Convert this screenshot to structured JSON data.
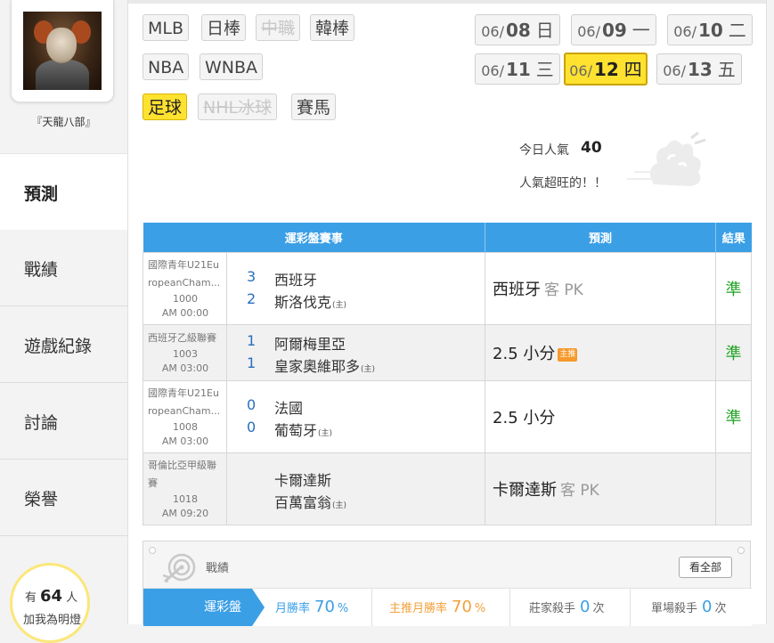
{
  "user": {
    "nickname": "『天龍八部』"
  },
  "nav": {
    "predict": "預測",
    "items": [
      "戰績",
      "遊戲紀錄",
      "討論",
      "榮譽"
    ]
  },
  "lamp": {
    "prefix": "有",
    "count": "64",
    "suffix": "人",
    "action": "加我為明燈"
  },
  "sports": [
    {
      "label": "MLB",
      "state": "normal"
    },
    {
      "label": "日棒",
      "state": "normal"
    },
    {
      "label": "中職",
      "state": "disabled"
    },
    {
      "label": "韓棒",
      "state": "normal"
    },
    {
      "label": "NBA",
      "state": "normal"
    },
    {
      "label": "WNBA",
      "state": "normal"
    },
    {
      "label": "足球",
      "state": "active"
    },
    {
      "label": "NHL冰球",
      "state": "disabled"
    },
    {
      "label": "賽馬",
      "state": "normal"
    }
  ],
  "dates": [
    {
      "md": "06/",
      "d": "08",
      "wd": "日",
      "active": false
    },
    {
      "md": "06/",
      "d": "09",
      "wd": "一",
      "active": false
    },
    {
      "md": "06/",
      "d": "10",
      "wd": "二",
      "active": false
    },
    {
      "md": "06/",
      "d": "11",
      "wd": "三",
      "active": false
    },
    {
      "md": "06/",
      "d": "12",
      "wd": "四",
      "active": true
    },
    {
      "md": "06/",
      "d": "13",
      "wd": "五",
      "active": false
    }
  ],
  "popularity": {
    "label": "今日人氣",
    "value": "40",
    "message": "人氣超旺的！！"
  },
  "table": {
    "headers": {
      "game": "運彩盤賽事",
      "prediction": "預測",
      "result": "結果"
    },
    "rows": [
      {
        "league": "國際青年U21EuropeanCham...",
        "game_no": "1000",
        "time": "AM 00:00",
        "away_score": "3",
        "away": "西班牙",
        "home_score": "2",
        "home": "斯洛伐克",
        "host_mark": "(主)",
        "pick": "西班牙",
        "pick_note": "客 PK",
        "badge": "",
        "result": "準"
      },
      {
        "league": "西班牙乙級聯賽",
        "game_no": "1003",
        "time": "AM 03:00",
        "away_score": "1",
        "away": "阿爾梅里亞",
        "home_score": "1",
        "home": "皇家奧維耶多",
        "host_mark": "(主)",
        "pick": "2.5 小分",
        "pick_note": "",
        "badge": "主推",
        "result": "準"
      },
      {
        "league": "國際青年U21EuropeanCham...",
        "game_no": "1008",
        "time": "AM 03:00",
        "away_score": "0",
        "away": "法國",
        "home_score": "0",
        "home": "葡萄牙",
        "host_mark": "(主)",
        "pick": "2.5 小分",
        "pick_note": "",
        "badge": "",
        "result": "準"
      },
      {
        "league": "哥倫比亞甲級聯賽",
        "game_no": "1018",
        "time": "AM 09:20",
        "away_score": "",
        "away": "卡爾達斯",
        "home_score": "",
        "home": "百萬富翁",
        "host_mark": "(主)",
        "pick": "卡爾達斯",
        "pick_note": "客 PK",
        "badge": "",
        "result": ""
      }
    ]
  },
  "record": {
    "title": "戰績",
    "view_all": "看全部",
    "tab": "運彩盤",
    "stats": [
      {
        "label": "月勝率",
        "value": "70",
        "unit": "%",
        "color": "#3b9fe6",
        "label_color": "#3b9fe6"
      },
      {
        "label": "主推月勝率",
        "value": "70",
        "unit": "%",
        "color": "#f2a03a",
        "label_color": "#f2a03a"
      },
      {
        "label": "莊家殺手",
        "value": "0",
        "unit": "次",
        "color": "#3b9fe6",
        "label_color": "#666"
      },
      {
        "label": "單場殺手",
        "value": "0",
        "unit": "次",
        "color": "#3b9fe6",
        "label_color": "#666"
      }
    ]
  },
  "colors": {
    "accent": "#3b9fe6",
    "active_yellow": "#ffe230",
    "win_green": "#22a325",
    "orange": "#f2a03a"
  }
}
